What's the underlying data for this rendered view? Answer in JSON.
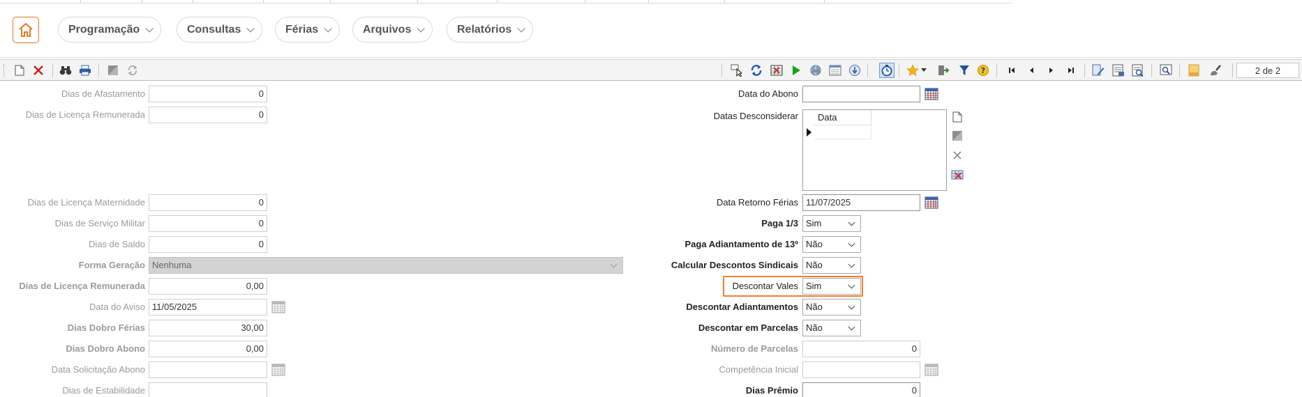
{
  "nav": {
    "menus": [
      {
        "label": "Programação"
      },
      {
        "label": "Consultas"
      },
      {
        "label": "Férias"
      },
      {
        "label": "Arquivos"
      },
      {
        "label": "Relatórios"
      }
    ]
  },
  "toolbar": {
    "pager": "2 de 2"
  },
  "left": {
    "dias_afastamento": {
      "label": "Dias de Afastamento",
      "value": "0"
    },
    "dias_licenca_remunerada_1": {
      "label": "Dias de Licença Remunerada",
      "value": "0"
    },
    "dias_licenca_maternidade": {
      "label": "Dias de Licença Maternidade",
      "value": "0"
    },
    "dias_servico_militar": {
      "label": "Dias de Serviço Militar",
      "value": "0"
    },
    "dias_saldo": {
      "label": "Dias de Saldo",
      "value": "0"
    },
    "forma_geracao": {
      "label": "Forma Geração",
      "value": "Nenhuma"
    },
    "dias_licenca_remunerada_2": {
      "label": "Dias de Licença Remunerada",
      "value": "0,00"
    },
    "data_aviso": {
      "label": "Data do Aviso",
      "value": "11/05/2025"
    },
    "dias_dobro_ferias": {
      "label": "Dias Dobro Férias",
      "value": "30,00"
    },
    "dias_dobro_abono": {
      "label": "Dias Dobro Abono",
      "value": "0,00"
    },
    "data_solicitacao_abono": {
      "label": "Data Solicitação Abono",
      "value": ""
    },
    "dias_estabilidade": {
      "label": "Dias de Estabilidade",
      "value": ""
    }
  },
  "right": {
    "data_abono": {
      "label": "Data do Abono",
      "value": ""
    },
    "datas_desconsiderar": {
      "label": "Datas Desconsiderar",
      "column": "Data"
    },
    "data_retorno_ferias": {
      "label": "Data Retorno Férias",
      "value": "11/07/2025"
    },
    "paga_um_terco": {
      "label": "Paga 1/3",
      "value": "Sim"
    },
    "paga_adiantamento_13": {
      "label": "Paga Adiantamento de 13º",
      "value": "Não"
    },
    "calcular_descontos_sindicais": {
      "label": "Calcular Descontos Sindicais",
      "value": "Não"
    },
    "descontar_vales": {
      "label": "Descontar Vales",
      "value": "Sim"
    },
    "descontar_adiantamentos": {
      "label": "Descontar Adiantamentos",
      "value": "Não"
    },
    "descontar_parcelas": {
      "label": "Descontar em Parcelas",
      "value": "Não"
    },
    "numero_parcelas": {
      "label": "Número de Parcelas",
      "value": "0"
    },
    "competencia_inicial": {
      "label": "Competência Inicial",
      "value": ""
    },
    "dias_premio": {
      "label": "Dias Prêmio",
      "value": "0"
    }
  },
  "colors": {
    "accent": "#ef7d34",
    "disabled_bg": "#d3d3d3"
  }
}
